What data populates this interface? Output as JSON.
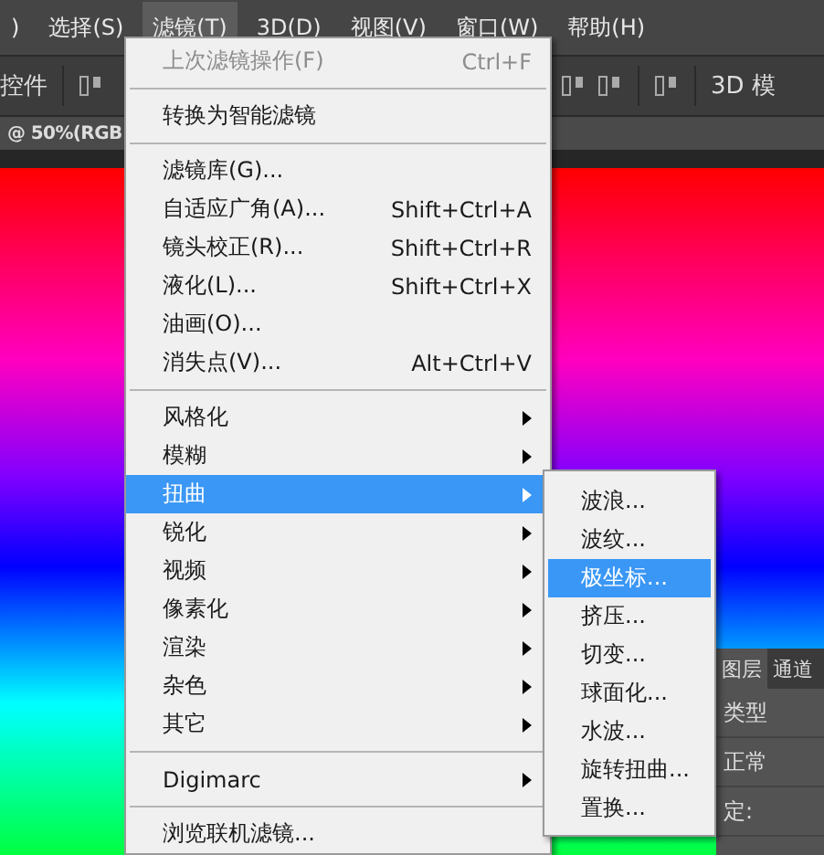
{
  "menubar": {
    "items": [
      {
        "label": ")",
        "selected": false
      },
      {
        "label": "选择(S)",
        "selected": false
      },
      {
        "label": "滤镜(T)",
        "selected": true
      },
      {
        "label": "3D(D)",
        "selected": false
      },
      {
        "label": "视图(V)",
        "selected": false
      },
      {
        "label": "窗口(W)",
        "selected": false
      },
      {
        "label": "帮助(H)",
        "selected": false
      }
    ]
  },
  "options_bar": {
    "left_label": "控件",
    "right_label": "3D 模"
  },
  "document_tab": {
    "title": "@ 50%(RGB"
  },
  "filter_menu": {
    "items": [
      {
        "kind": "item",
        "label": "上次滤镜操作(F)",
        "shortcut": "Ctrl+F",
        "disabled": true,
        "selected": false
      },
      {
        "kind": "separator"
      },
      {
        "kind": "item",
        "label": "转换为智能滤镜",
        "disabled": false,
        "selected": false
      },
      {
        "kind": "separator"
      },
      {
        "kind": "item",
        "label": "滤镜库(G)...",
        "disabled": false,
        "selected": false
      },
      {
        "kind": "item",
        "label": "自适应广角(A)...",
        "shortcut": "Shift+Ctrl+A",
        "disabled": false,
        "selected": false
      },
      {
        "kind": "item",
        "label": "镜头校正(R)...",
        "shortcut": "Shift+Ctrl+R",
        "disabled": false,
        "selected": false
      },
      {
        "kind": "item",
        "label": "液化(L)...",
        "shortcut": "Shift+Ctrl+X",
        "disabled": false,
        "selected": false
      },
      {
        "kind": "item",
        "label": "油画(O)...",
        "disabled": false,
        "selected": false
      },
      {
        "kind": "item",
        "label": "消失点(V)...",
        "shortcut": "Alt+Ctrl+V",
        "disabled": false,
        "selected": false
      },
      {
        "kind": "separator"
      },
      {
        "kind": "submenu",
        "label": "风格化",
        "disabled": false,
        "selected": false
      },
      {
        "kind": "submenu",
        "label": "模糊",
        "disabled": false,
        "selected": false
      },
      {
        "kind": "submenu",
        "label": "扭曲",
        "disabled": false,
        "selected": true
      },
      {
        "kind": "submenu",
        "label": "锐化",
        "disabled": false,
        "selected": false
      },
      {
        "kind": "submenu",
        "label": "视频",
        "disabled": false,
        "selected": false
      },
      {
        "kind": "submenu",
        "label": "像素化",
        "disabled": false,
        "selected": false
      },
      {
        "kind": "submenu",
        "label": "渲染",
        "disabled": false,
        "selected": false
      },
      {
        "kind": "submenu",
        "label": "杂色",
        "disabled": false,
        "selected": false
      },
      {
        "kind": "submenu",
        "label": "其它",
        "disabled": false,
        "selected": false
      },
      {
        "kind": "separator"
      },
      {
        "kind": "submenu",
        "label": "Digimarc",
        "disabled": false,
        "selected": false
      },
      {
        "kind": "separator"
      },
      {
        "kind": "item",
        "label": "浏览联机滤镜...",
        "disabled": false,
        "selected": false
      }
    ]
  },
  "distort_submenu": {
    "items": [
      {
        "label": "波浪...",
        "selected": false
      },
      {
        "label": "波纹...",
        "selected": false
      },
      {
        "label": "极坐标...",
        "selected": true
      },
      {
        "label": "挤压...",
        "selected": false
      },
      {
        "label": "切变...",
        "selected": false
      },
      {
        "label": "球面化...",
        "selected": false
      },
      {
        "label": "水波...",
        "selected": false
      },
      {
        "label": "旋转扭曲...",
        "selected": false
      },
      {
        "label": "置换...",
        "selected": false
      }
    ]
  },
  "layers_panel": {
    "tabs": [
      {
        "label": "图层",
        "selected": true
      },
      {
        "label": "通道",
        "selected": false
      }
    ],
    "filter_label": "类型",
    "blend_mode": "正常",
    "lock_label": "定:"
  }
}
